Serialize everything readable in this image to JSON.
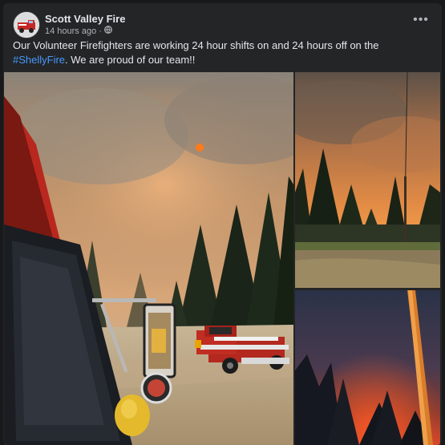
{
  "post": {
    "author": "Scott Valley Fire",
    "time": "14 hours ago",
    "visibility_icon": "globe-icon",
    "more_icon": "more-options-icon",
    "text_before": "Our Volunteer Firefighters are working 24 hour shifts on and 24 hours off on the ",
    "hashtag": "#ShellyFire",
    "text_after": ". We are proud of our team!!"
  },
  "colors": {
    "background": "#18191a",
    "card": "#242526",
    "link": "#4599ff",
    "secondary_text": "#b0b3b8"
  },
  "photos": [
    {
      "id": "photo-1",
      "description": "fire engine view of smoke-filled sky with red pickup truck and pine trees"
    },
    {
      "id": "photo-2",
      "description": "orange smoke sky over pine trees and dry meadow"
    },
    {
      "id": "photo-3",
      "description": "night fire glow behind trees and power pole"
    }
  ]
}
